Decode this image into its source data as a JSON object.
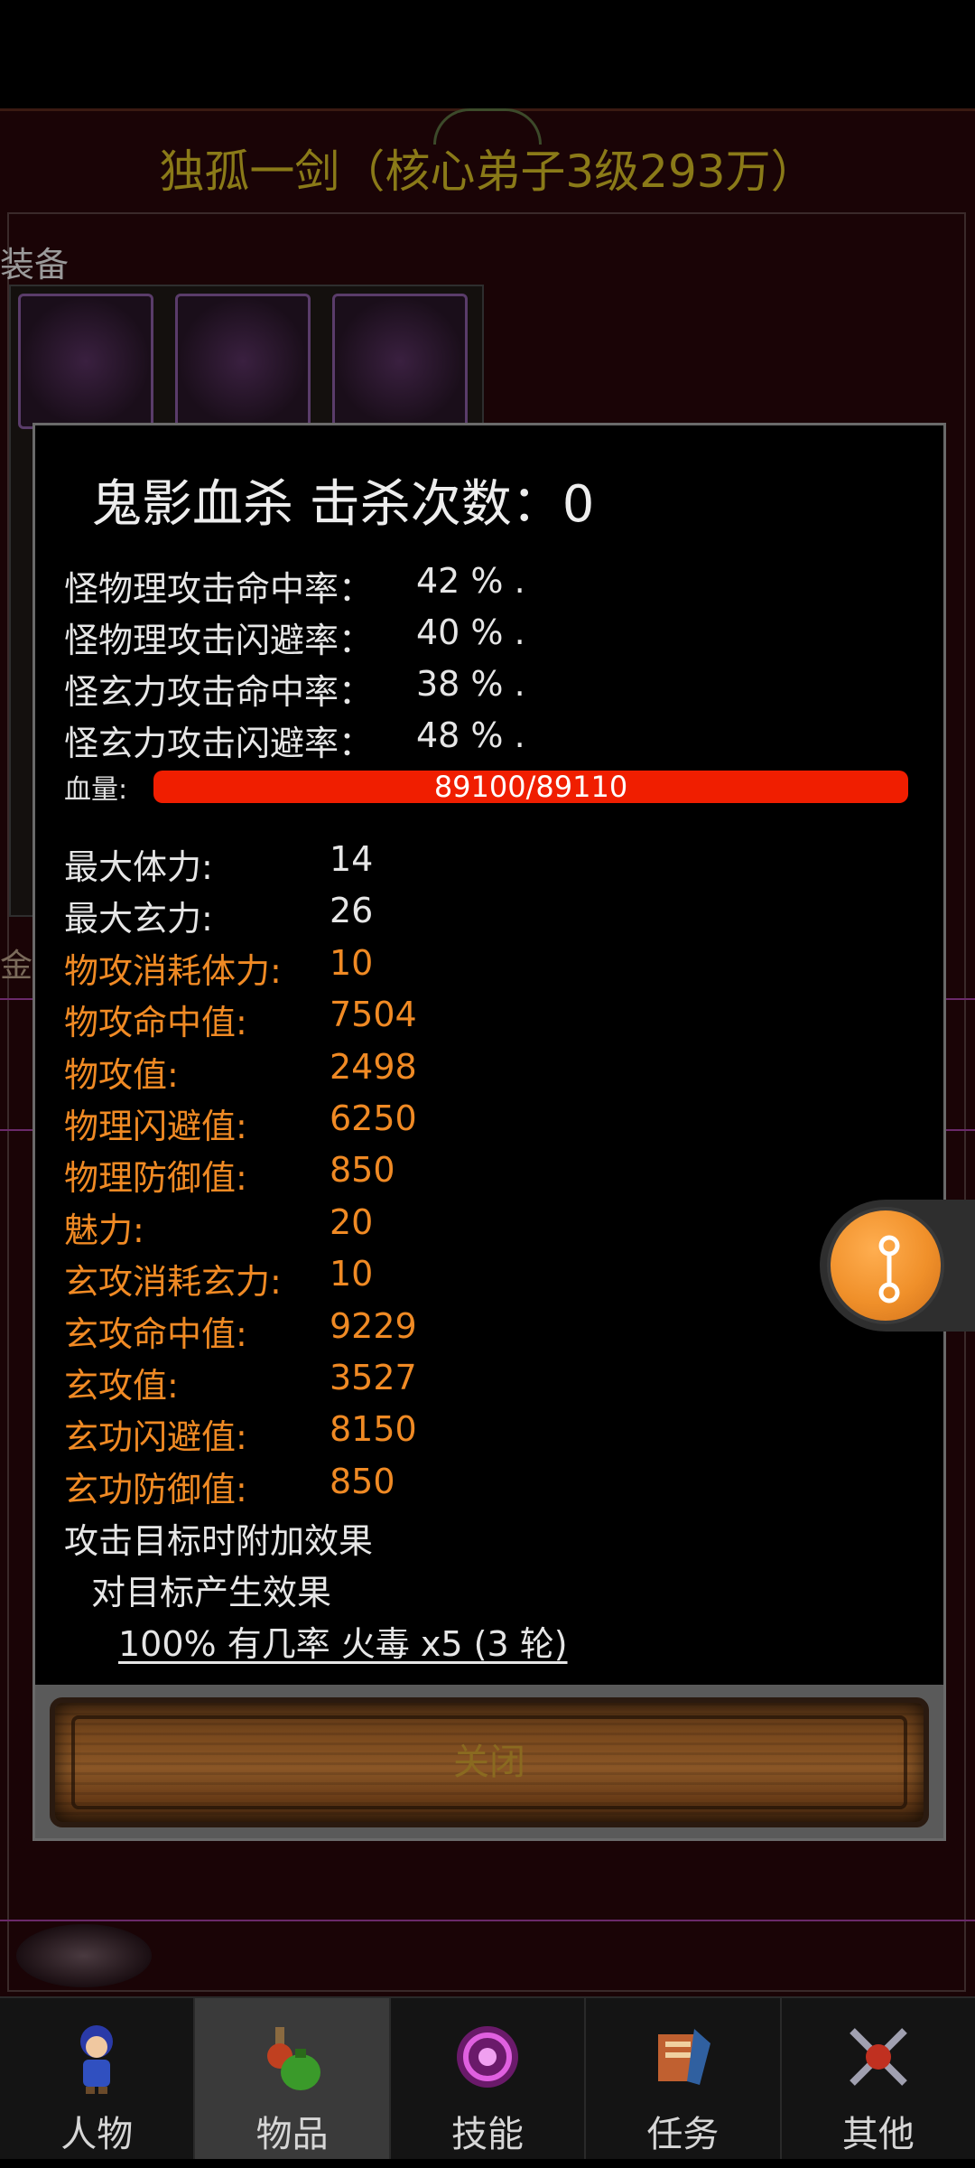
{
  "background": {
    "title": "独孤一剑（核心弟子3级293万）",
    "equip_label": "装备",
    "gold_label": "金币"
  },
  "dialog": {
    "title": "鬼影血杀  击杀次数：0",
    "rates": [
      {
        "label": "怪物理攻击命中率：",
        "value": "42 % ."
      },
      {
        "label": "怪物理攻击闪避率：",
        "value": "40 % ."
      },
      {
        "label": "怪玄力攻击命中率：",
        "value": "38 % ."
      },
      {
        "label": "怪玄力攻击闪避率：",
        "value": "48 % ."
      }
    ],
    "hp": {
      "label": "血量:",
      "text": "89100/89110",
      "current": 89100,
      "max": 89110
    },
    "stats": [
      {
        "label": "最大体力:",
        "value": "14",
        "color": "white"
      },
      {
        "label": "最大玄力:",
        "value": "26",
        "color": "white"
      },
      {
        "label": "物攻消耗体力:",
        "value": "10",
        "color": "orange"
      },
      {
        "label": "物攻命中值:",
        "value": "7504",
        "color": "orange"
      },
      {
        "label": "物攻值:",
        "value": "2498",
        "color": "orange"
      },
      {
        "label": "物理闪避值:",
        "value": "6250",
        "color": "orange"
      },
      {
        "label": "物理防御值:",
        "value": "850",
        "color": "orange"
      },
      {
        "label": "魅力:",
        "value": "20",
        "color": "orange"
      },
      {
        "label": "玄攻消耗玄力:",
        "value": "10",
        "color": "orange"
      },
      {
        "label": "玄攻命中值:",
        "value": "9229",
        "color": "orange"
      },
      {
        "label": "玄攻值:",
        "value": "3527",
        "color": "orange"
      },
      {
        "label": "玄功闪避值:",
        "value": "8150",
        "color": "orange"
      },
      {
        "label": "玄功防御值:",
        "value": "850",
        "color": "orange"
      }
    ],
    "effect_heading": "攻击目标时附加效果",
    "effect_sub": "对目标产生效果",
    "effect_detail": "100% 有几率 火毒 x5 (3 轮)",
    "close_label": "关闭"
  },
  "nav": [
    {
      "label": "人物",
      "icon": "character-icon",
      "active": false
    },
    {
      "label": "物品",
      "icon": "potion-bag-icon",
      "active": true
    },
    {
      "label": "技能",
      "icon": "skill-swirl-icon",
      "active": false
    },
    {
      "label": "任务",
      "icon": "task-scroll-icon",
      "active": false
    },
    {
      "label": "其他",
      "icon": "crossed-weapons-icon",
      "active": false
    }
  ],
  "colors": {
    "orange": "#f08a24",
    "hp_bar": "#f01e00",
    "float_button": "#f0902a"
  }
}
